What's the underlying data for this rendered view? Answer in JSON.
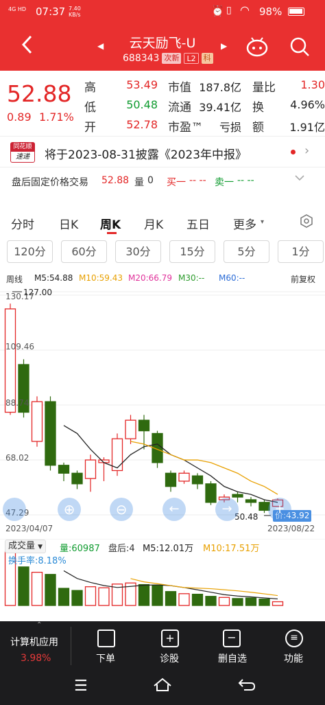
{
  "status_bar": {
    "network": "4G HD",
    "time": "07:37",
    "speed_value": "7.40",
    "speed_unit": "KB/s",
    "battery": "98%"
  },
  "header": {
    "title": "云天励飞-U",
    "code": "688343",
    "tag_new": "次新",
    "tag_l2": "L2",
    "tag_board": "科"
  },
  "quote": {
    "price": "52.88",
    "change": "0.89",
    "change_pct": "1.71%",
    "high_label": "高",
    "high": "53.49",
    "low_label": "低",
    "low": "50.48",
    "open_label": "开",
    "open": "52.78",
    "mcap_label": "市值",
    "mcap": "187.8亿",
    "float_label": "流通",
    "float": "39.41亿",
    "pe_label": "市盈™",
    "pe": "亏损",
    "vol_ratio_label": "量比",
    "vol_ratio": "1.30",
    "turnover_label": "换",
    "turnover": "4.96%",
    "amount_label": "额",
    "amount": "1.91亿"
  },
  "news": {
    "brand_top": "同花顺",
    "brand_bottom": "速递",
    "text": "将于2023-08-31披露《2023年中报》"
  },
  "after_hours": {
    "label": "盘后固定价格交易",
    "price": "52.88",
    "vol_label": "量",
    "vol": "0",
    "buy_label": "买一",
    "buy_val": "-- --",
    "sell_label": "卖一",
    "sell_val": "-- --"
  },
  "tabs": [
    "分时",
    "日K",
    "周K",
    "月K",
    "五日",
    "更多"
  ],
  "active_tab": 2,
  "subtabs": [
    "120分",
    "60分",
    "30分",
    "15分",
    "5分",
    "1分"
  ],
  "ma_legend": {
    "period": "周线",
    "m5": "M5:54.88",
    "m10": "M10:59.43",
    "m20": "M20:66.79",
    "m30": "M30:--",
    "m60": "M60:--",
    "adjust": "前复权"
  },
  "chart_data": {
    "type": "candlestick",
    "y_ticks": [
      "130.17",
      "109.46",
      "88.74",
      "68.02",
      "47.29"
    ],
    "ylim": [
      47.29,
      130.17
    ],
    "annotations": {
      "max_marker": "127.00",
      "min_marker": "50.48",
      "price_tag": "价:43.92"
    },
    "x_start_label": "2023/04/07",
    "x_end_label": "2023/08/22",
    "candles": [
      {
        "o": 86.0,
        "c": 125.0,
        "h": 127.0,
        "l": 85.0
      },
      {
        "o": 104.0,
        "c": 86.0,
        "h": 106.0,
        "l": 84.0
      },
      {
        "o": 75.0,
        "c": 90.0,
        "h": 92.0,
        "l": 73.0
      },
      {
        "o": 90.0,
        "c": 66.0,
        "h": 92.0,
        "l": 64.0
      },
      {
        "o": 66.0,
        "c": 63.0,
        "h": 67.0,
        "l": 60.0
      },
      {
        "o": 63.0,
        "c": 59.0,
        "h": 64.0,
        "l": 57.0
      },
      {
        "o": 61.0,
        "c": 68.0,
        "h": 70.0,
        "l": 56.0
      },
      {
        "o": 67.0,
        "c": 68.0,
        "h": 69.0,
        "l": 60.0
      },
      {
        "o": 64.0,
        "c": 76.0,
        "h": 78.0,
        "l": 62.0
      },
      {
        "o": 76.0,
        "c": 83.0,
        "h": 85.0,
        "l": 74.0
      },
      {
        "o": 83.0,
        "c": 79.0,
        "h": 85.0,
        "l": 72.0
      },
      {
        "o": 78.0,
        "c": 67.0,
        "h": 79.0,
        "l": 65.0
      },
      {
        "o": 63.0,
        "c": 58.0,
        "h": 64.0,
        "l": 56.0
      },
      {
        "o": 60.0,
        "c": 63.0,
        "h": 64.0,
        "l": 59.0
      },
      {
        "o": 62.0,
        "c": 59.0,
        "h": 63.0,
        "l": 57.0
      },
      {
        "o": 59.0,
        "c": 52.0,
        "h": 60.0,
        "l": 51.0
      },
      {
        "o": 53.0,
        "c": 54.0,
        "h": 55.0,
        "l": 52.0
      },
      {
        "o": 55.0,
        "c": 54.0,
        "h": 56.0,
        "l": 52.0
      },
      {
        "o": 53.0,
        "c": 52.0,
        "h": 54.0,
        "l": 50.5
      },
      {
        "o": 52.0,
        "c": 49.0,
        "h": 53.0,
        "l": 48.0
      },
      {
        "o": 50.5,
        "c": 52.9,
        "h": 53.5,
        "l": 50.5
      }
    ],
    "ma5": [
      null,
      null,
      null,
      null,
      81.0,
      78.0,
      72.0,
      67.0,
      65.0,
      70.0,
      73.0,
      74.0,
      70.0,
      68.0,
      65.0,
      62.0,
      58.0,
      56.0,
      55.0,
      53.0,
      52.0
    ],
    "ma10": [
      null,
      null,
      null,
      null,
      null,
      null,
      null,
      null,
      null,
      75.0,
      74.0,
      72.0,
      70.0,
      68.0,
      68.0,
      67.0,
      65.0,
      63.0,
      60.0,
      58.0,
      55.0
    ]
  },
  "volume": {
    "dropdown": "成交量",
    "vol": "量:60987",
    "after": "盘后:4",
    "m5": "M5:12.01万",
    "m10": "M10:17.51万",
    "turnover": "换手率:8.18%",
    "bars": [
      1.0,
      0.72,
      0.62,
      0.58,
      0.32,
      0.28,
      0.35,
      0.33,
      0.4,
      0.42,
      0.39,
      0.38,
      0.26,
      0.22,
      0.21,
      0.17,
      0.15,
      0.13,
      0.14,
      0.12,
      0.07
    ]
  },
  "bottom_nav": {
    "calc_app_label": "计算机应用",
    "calc_app_pct": "3.98%",
    "items": [
      "下单",
      "诊股",
      "删自选",
      "功能"
    ]
  },
  "colors": {
    "header": "#e93030",
    "up": "#e32626",
    "down": "#2f6a0f",
    "ma5": "#222222",
    "ma10": "#e8a000"
  }
}
